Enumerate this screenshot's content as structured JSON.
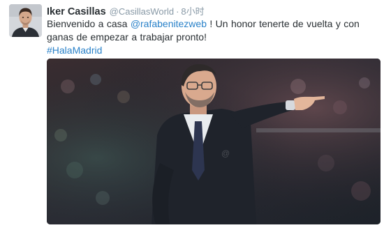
{
  "tweet": {
    "author": {
      "name": "Iker Casillas",
      "handle": "@CasillasWorld",
      "avatar": "user-avatar-photo"
    },
    "separator": "·",
    "time": "8小时",
    "text": {
      "part1": "Bienvenido a casa ",
      "mention": "@rafabenitezweb",
      "part2": " ! Un honor tenerte de vuelta y con ganas de empezar a trabajar pronto!",
      "hashtag": "#HalaMadrid"
    },
    "media": {
      "type": "photo",
      "description_icon": "coach-pointing-photo"
    },
    "colors": {
      "link": "#2a82c9",
      "name": "#292f33",
      "meta": "#8899a6"
    }
  }
}
